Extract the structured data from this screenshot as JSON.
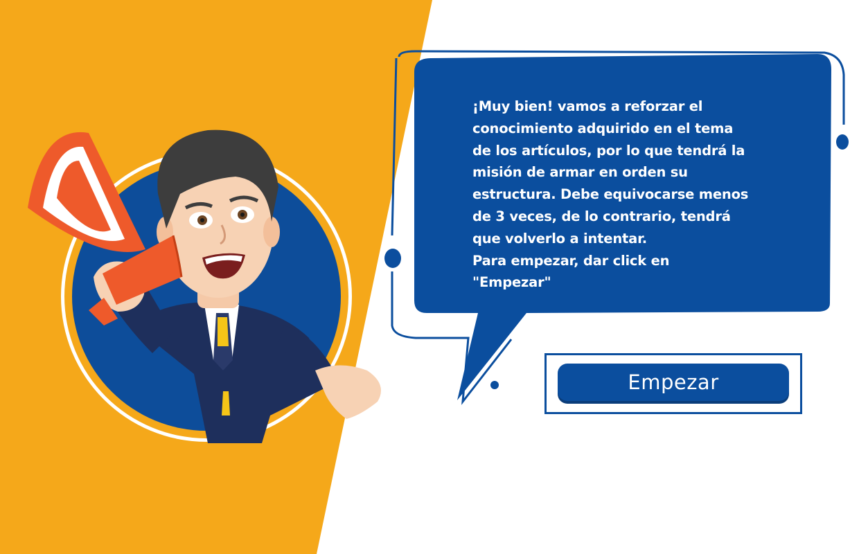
{
  "message": {
    "lines": [
      "¡Muy bien! vamos a reforzar el",
      "conocimiento adquirido en el tema",
      "de los artículos, por lo que tendrá la",
      "misión de armar en orden su",
      "estructura. Debe equivocarse menos",
      "de 3 veces, de lo contrario, tendrá",
      "que volverlo a intentar.",
      "Para empezar, dar click en",
      "\"Empezar\""
    ]
  },
  "start_button": {
    "label": "Empezar"
  },
  "colors": {
    "orange_background": "#F5A81A",
    "bubble_blue": "#0B4E9E",
    "button_blue": "#0B4E9E",
    "megaphone_red": "#EE5A2B",
    "suit_navy": "#1E2F5C"
  },
  "illustration": {
    "character": "cartoon businessman with megaphone",
    "icons": [
      "megaphone-icon"
    ]
  }
}
